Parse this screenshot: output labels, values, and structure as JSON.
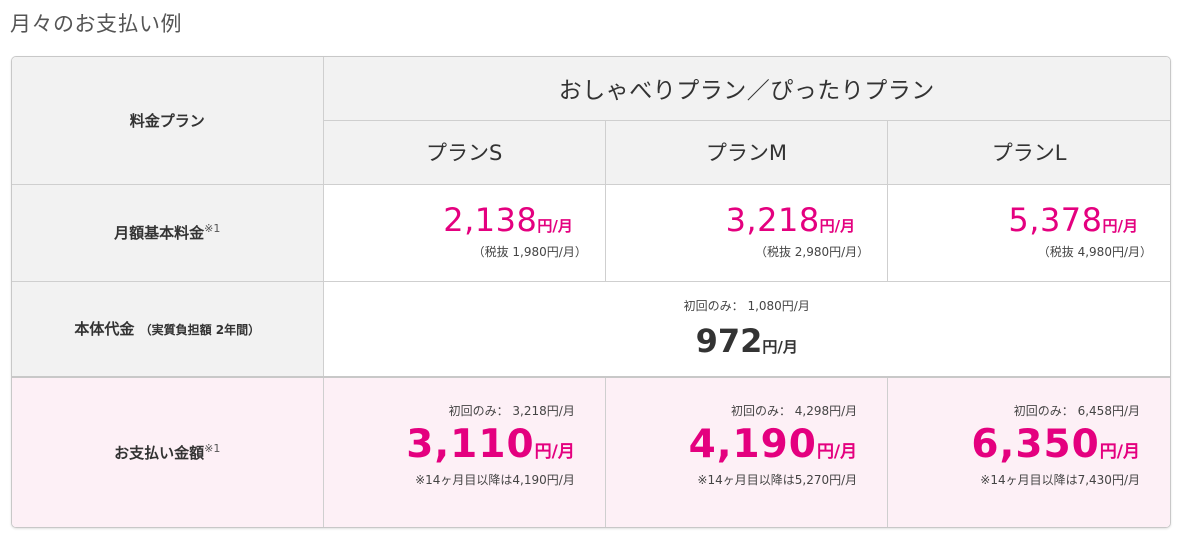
{
  "heading": "月々のお支払い例",
  "header": {
    "label": "料金プラン",
    "group": "おしゃべりプラン／ぴったりプラン",
    "plans": [
      "プランS",
      "プランM",
      "プランL"
    ]
  },
  "monthly": {
    "label": "月額基本料金",
    "note": "※1",
    "unit": "円/月",
    "items": [
      {
        "price": "2,138",
        "tax": "（税抜 1,980円/月）"
      },
      {
        "price": "3,218",
        "tax": "（税抜 2,980円/月）"
      },
      {
        "price": "5,378",
        "tax": "（税抜 4,980円/月）"
      }
    ]
  },
  "device": {
    "label": "本体代金",
    "sub": "（実質負担額 2年間）",
    "first": "初回のみ： 1,080円/月",
    "price": "972",
    "unit": "円/月"
  },
  "payment": {
    "label": "お支払い金額",
    "note": "※1",
    "unit": "円/月",
    "items": [
      {
        "first": "初回のみ： 3,218円/月",
        "price": "3,110",
        "later": "※14ヶ月目以降は4,190円/月"
      },
      {
        "first": "初回のみ： 4,298円/月",
        "price": "4,190",
        "later": "※14ヶ月目以降は5,270円/月"
      },
      {
        "first": "初回のみ： 6,458円/月",
        "price": "6,350",
        "later": "※14ヶ月目以降は7,430円/月"
      }
    ]
  },
  "colors": {
    "accent": "#e4007f",
    "header_bg": "#f2f2f2",
    "payment_bg": "#fdf0f6"
  }
}
